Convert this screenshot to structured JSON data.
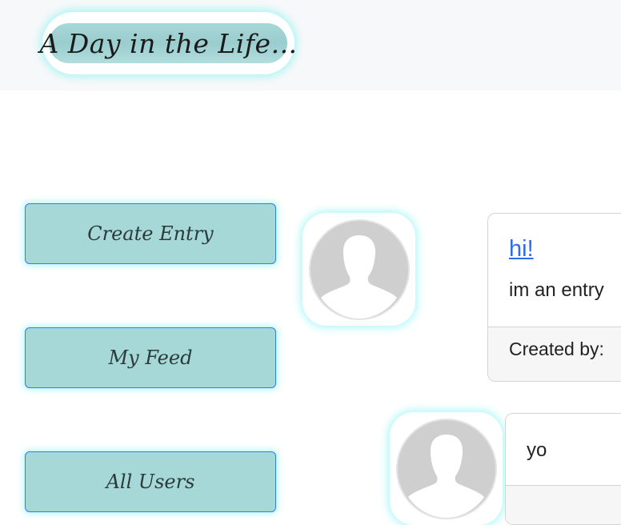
{
  "header": {
    "logo_text": "A Day in the Life..."
  },
  "nav": {
    "create_entry": "Create Entry",
    "my_feed": "My Feed",
    "all_users": "All Users"
  },
  "entries": [
    {
      "title": "hi!",
      "body": "im an entry",
      "footer": "Created by:"
    },
    {
      "body": "yo"
    }
  ],
  "colors": {
    "button_bg": "#a7d8d8",
    "button_border": "#2f7cf6",
    "glow": "#80f2f2",
    "link": "#2f6ee8"
  },
  "icons": {
    "avatar": "default-user-avatar-icon"
  }
}
